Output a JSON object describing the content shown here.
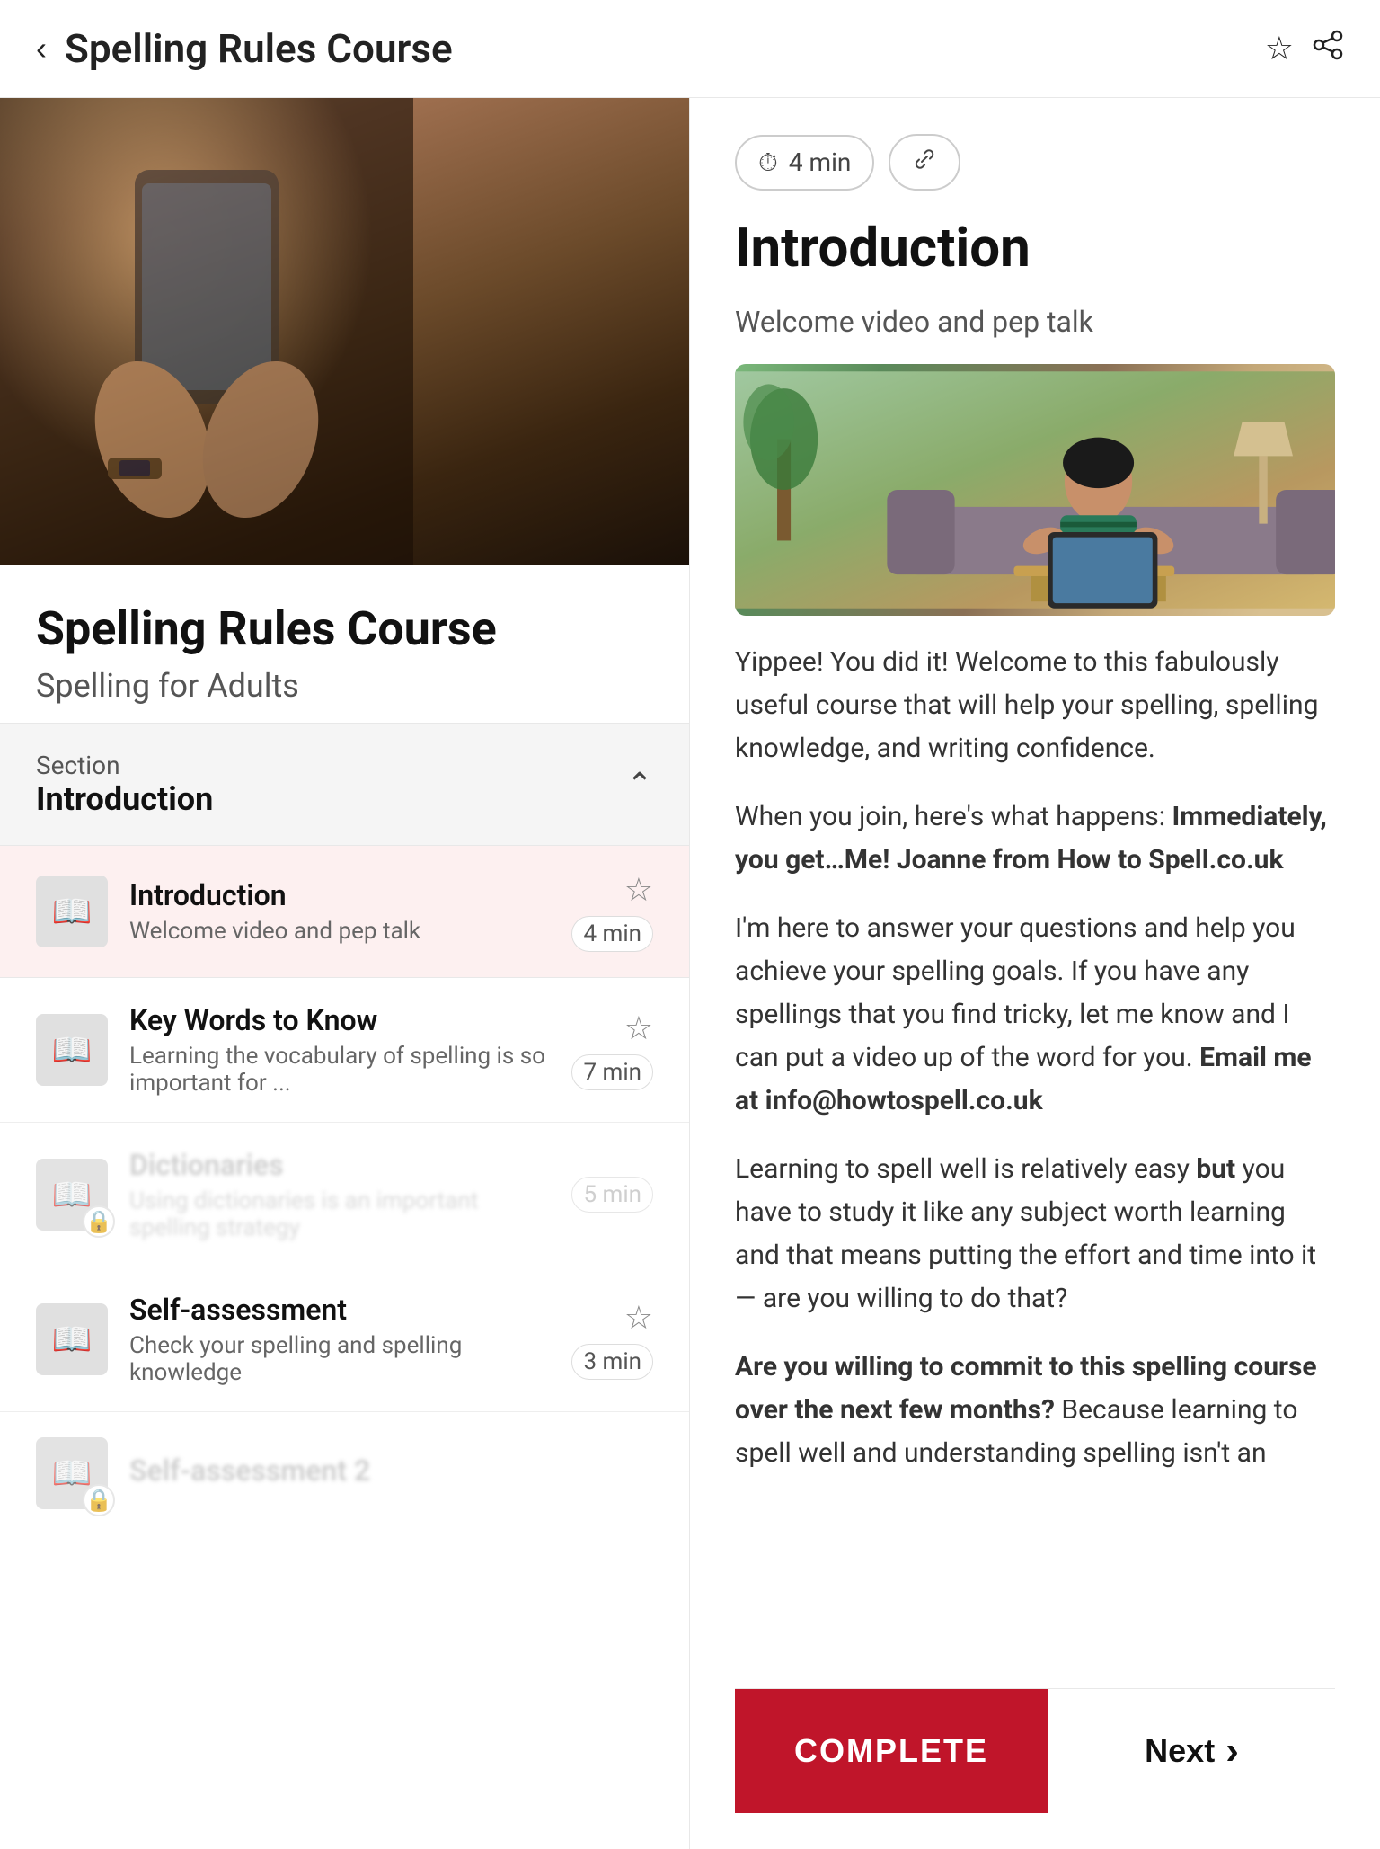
{
  "header": {
    "title": "Spelling Rules Course",
    "back_label": "‹",
    "bookmark_icon": "☆",
    "share_icon": "🔗"
  },
  "left": {
    "course_title": "Spelling Rules Course",
    "course_subtitle": "Spelling for Adults",
    "section": {
      "label": "Section",
      "name": "Introduction"
    },
    "lessons": [
      {
        "id": 1,
        "title": "Introduction",
        "desc": "Welcome video and pep talk",
        "duration": "4 min",
        "active": true,
        "locked": false,
        "starred": false
      },
      {
        "id": 2,
        "title": "Key Words to Know",
        "desc": "Learning the vocabulary of spelling is so important for ...",
        "duration": "7 min",
        "active": false,
        "locked": false,
        "starred": false
      },
      {
        "id": 3,
        "title": "Dictionaries",
        "desc": "Using dictionaries is an important spelling strategy",
        "duration": "5 min",
        "active": false,
        "locked": true,
        "starred": false
      },
      {
        "id": 4,
        "title": "Self-assessment",
        "desc": "Check your spelling and spelling knowledge",
        "duration": "3 min",
        "active": false,
        "locked": false,
        "starred": false
      },
      {
        "id": 5,
        "title": "Self-assessment 2",
        "desc": "",
        "duration": "",
        "active": false,
        "locked": true,
        "starred": false
      }
    ]
  },
  "right": {
    "duration": "4 min",
    "duration_icon": "⏱",
    "link_icon": "🔗",
    "title": "Introduction",
    "subtitle": "Welcome video and pep talk",
    "body_paragraphs": [
      "Yippee! You did it! Welcome to this fabulously useful course that will help your spelling, spelling knowledge, and writing confidence.",
      "When you join, here's what happens: **Immediately, you get…Me! Joanne from How to Spell.co.uk**",
      "I'm here to answer your questions and help you achieve your spelling goals. If you have any spellings that you find tricky, let me know and I can put a video up of the word for you. **Email me at info@howtospell.co.uk**",
      "Learning to spell well is relatively easy **but** you have to study it like any subject worth learning and that means putting the effort and time into it — are you willing to do that?",
      "**Are you willing to commit to this spelling course over the next few months?** Because learning to spell well and understanding spelling isn't an"
    ],
    "complete_label": "COMPLETE",
    "next_label": "Next",
    "next_icon": "›"
  }
}
